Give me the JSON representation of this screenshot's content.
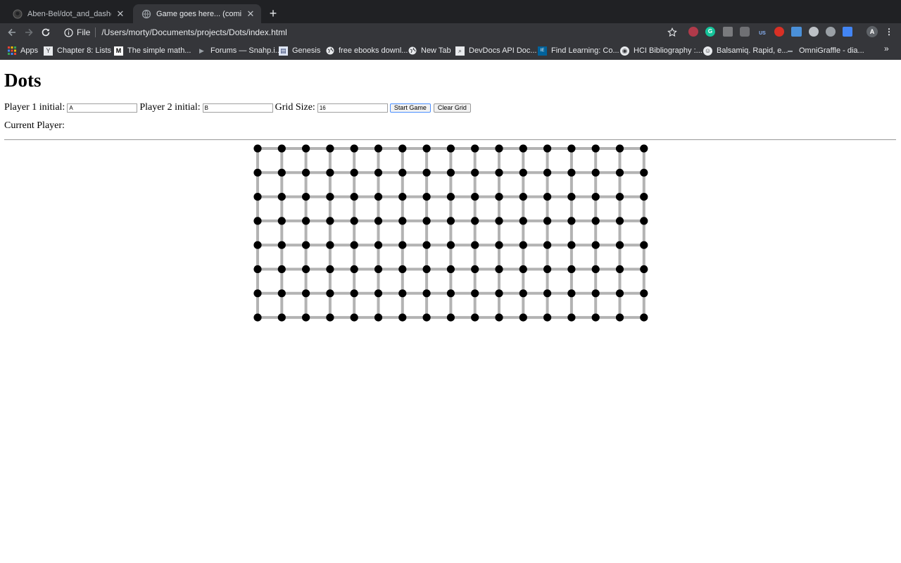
{
  "browser": {
    "tabs": [
      {
        "title": "Aben-Bel/dot_and_dashes: A g",
        "icon": "github-icon"
      },
      {
        "title": "Game goes here... (coming soo",
        "icon": "globe-icon"
      }
    ],
    "address": {
      "scheme": "File",
      "url": "/Users/morty/Documents/projects/Dots/index.html"
    },
    "extension_labels": {
      "us": "US",
      "profile": "A"
    },
    "bookmarks": [
      {
        "label": "Apps",
        "icon": "apps-grid-icon"
      },
      {
        "label": "Chapter 8: Lists",
        "icon": "y-icon"
      },
      {
        "label": "The simple math...",
        "icon": "medium-icon"
      },
      {
        "label": "Forums — Snahp.i...",
        "icon": "play-icon"
      },
      {
        "label": "Genesis",
        "icon": "book-icon"
      },
      {
        "label": "free ebooks downl...",
        "icon": "globe-icon"
      },
      {
        "label": "New Tab",
        "icon": "globe-icon"
      },
      {
        "label": "DevDocs API Doc...",
        "icon": "devdocs-icon"
      },
      {
        "label": "Find Learning: Co...",
        "icon": "ieee-icon"
      },
      {
        "label": "HCI Bibliography :...",
        "icon": "eye-icon"
      },
      {
        "label": "Balsamiq. Rapid, e...",
        "icon": "smile-icon"
      },
      {
        "label": "OmniGraffle - dia...",
        "icon": "omni-icon"
      }
    ]
  },
  "page": {
    "title": "Dots",
    "player1": {
      "label": "Player 1 initial:",
      "value": "A"
    },
    "player2": {
      "label": "Player 2 initial:",
      "value": "B"
    },
    "grid_size": {
      "label": "Grid Size:",
      "value": "16"
    },
    "start_button": "Start Game",
    "clear_button": "Clear Grid",
    "current_player_label": "Current Player:",
    "current_player_value": ""
  },
  "board": {
    "columns": 17,
    "rows": 8,
    "dot_color": "#000000",
    "line_color": "#b3b3b3"
  }
}
